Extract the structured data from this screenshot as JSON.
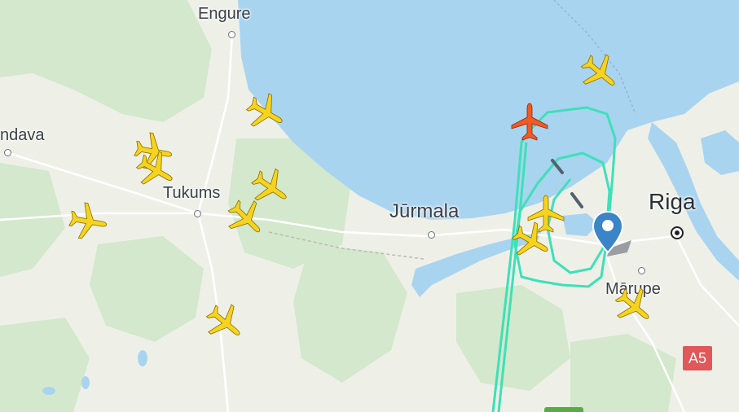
{
  "places": {
    "engure": "Engure",
    "kandava": "ndava",
    "tukums": "Tukums",
    "jurmala": "Jūrmala",
    "riga": "Riga",
    "marupe": "Mārupe"
  },
  "road_shield": "A5",
  "colors": {
    "water": "#a9d4f0",
    "land": "#eef0e8",
    "forest": "#cfe6c8",
    "track": "#3ee0b8",
    "plane_default": "#f6d31e",
    "plane_selected": "#f05a23",
    "pin": "#3a84c8",
    "road_shield": "#e0585a"
  },
  "aircraft": [
    {
      "id": "plane-1",
      "selected": false
    },
    {
      "id": "plane-2",
      "selected": false
    },
    {
      "id": "plane-3",
      "selected": false
    },
    {
      "id": "plane-4",
      "selected": false
    },
    {
      "id": "plane-5",
      "selected": false
    },
    {
      "id": "plane-6",
      "selected": false
    },
    {
      "id": "plane-7",
      "selected": false
    },
    {
      "id": "plane-8",
      "selected": false
    },
    {
      "id": "plane-9",
      "selected": false
    },
    {
      "id": "plane-10",
      "selected": true
    },
    {
      "id": "plane-11",
      "selected": false
    },
    {
      "id": "plane-12",
      "selected": false
    },
    {
      "id": "plane-13",
      "selected": false
    }
  ]
}
